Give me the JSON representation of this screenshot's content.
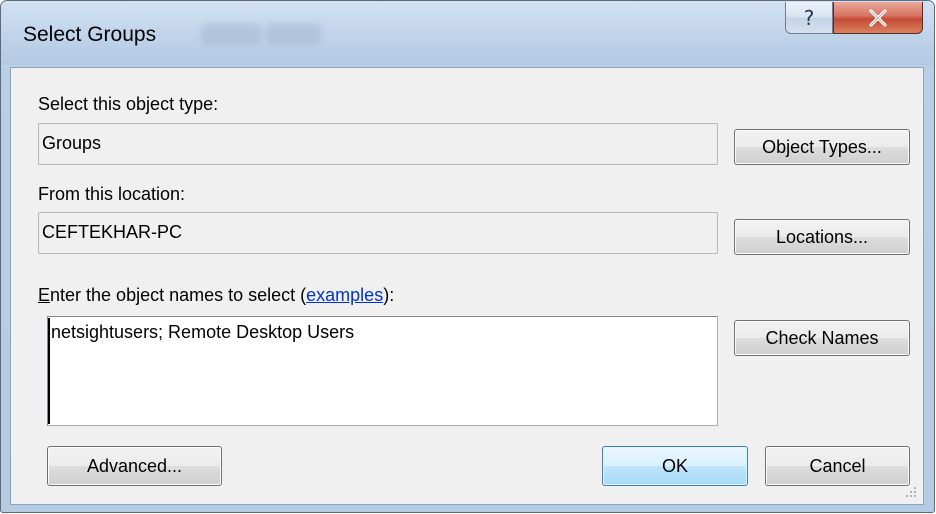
{
  "window": {
    "title": "Select Groups",
    "help_glyph": "?"
  },
  "object_type": {
    "label": "Select this object type:",
    "value": "Groups",
    "button": "Object Types..."
  },
  "location": {
    "label": "From this location:",
    "value": "CEFTEKHAR-PC",
    "button": "Locations..."
  },
  "names": {
    "label_mnemonic": "E",
    "label_rest": "nter the object names to select (",
    "link": "examples",
    "label_end": "):",
    "value": "netsightusers; Remote Desktop Users",
    "check_button": "Check Names"
  },
  "footer": {
    "advanced": "Advanced...",
    "ok": "OK",
    "cancel": "Cancel"
  },
  "colors": {
    "dialog_bg": "#f0f0f0",
    "titlebar": "#c6d8ec",
    "close_red": "#c44a33",
    "link": "#0033cc",
    "default_button": "#bee6fd"
  }
}
